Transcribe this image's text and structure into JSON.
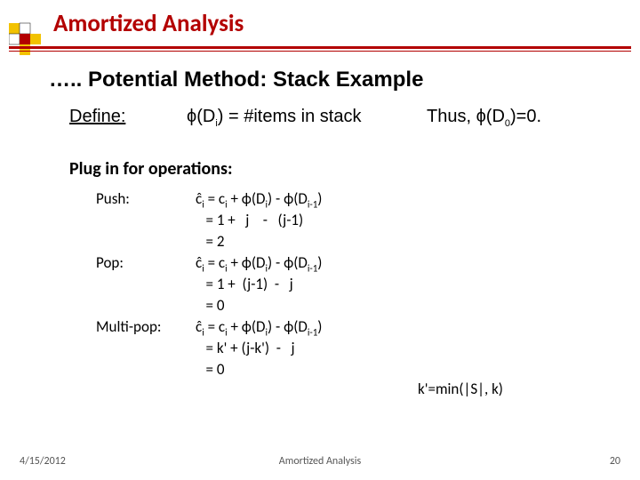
{
  "header": "Amortized Analysis",
  "subtitle": "….. Potential Method: Stack Example",
  "define": {
    "label": "Define:",
    "equation_pre": "ϕ(D",
    "equation_sub": "i",
    "equation_post": ") = #items in stack",
    "thus_pre": "Thus, ϕ(D",
    "thus_sub": "0",
    "thus_post": ")=0."
  },
  "plug": "Plug in for operations:",
  "ops": {
    "push": {
      "name": "Push:",
      "l1a": "ĉ",
      "l1b": "i",
      "l1c": " = c",
      "l1d": "i",
      "l1e": " + ϕ(D",
      "l1f": "i",
      "l1g": ") - ϕ(D",
      "l1h": "i-1",
      "l1i": ")",
      "l2": "   = 1 +   j    -   (j-1)",
      "l3": "   = 2"
    },
    "pop": {
      "name": "Pop:",
      "l1a": "ĉ",
      "l1b": "i",
      "l1c": " = c",
      "l1d": "i",
      "l1e": " + ϕ(D",
      "l1f": "i",
      "l1g": ") - ϕ(D",
      "l1h": "i-1",
      "l1i": ")",
      "l2": "   = 1 +  (j-1)  -   j",
      "l3": "   = 0"
    },
    "multipop": {
      "name": "Multi-pop:",
      "l1a": "ĉ",
      "l1b": "i",
      "l1c": " = c",
      "l1d": "i",
      "l1e": " + ϕ(D",
      "l1f": "i",
      "l1g": ") - ϕ(D",
      "l1h": "i-1",
      "l1i": ")",
      "l2": "   = k' + (j-k')  -   j",
      "l3": "   = 0"
    }
  },
  "note": "k'=min(|S|, k)",
  "footer": {
    "date": "4/15/2012",
    "title": "Amortized Analysis",
    "page": "20"
  }
}
